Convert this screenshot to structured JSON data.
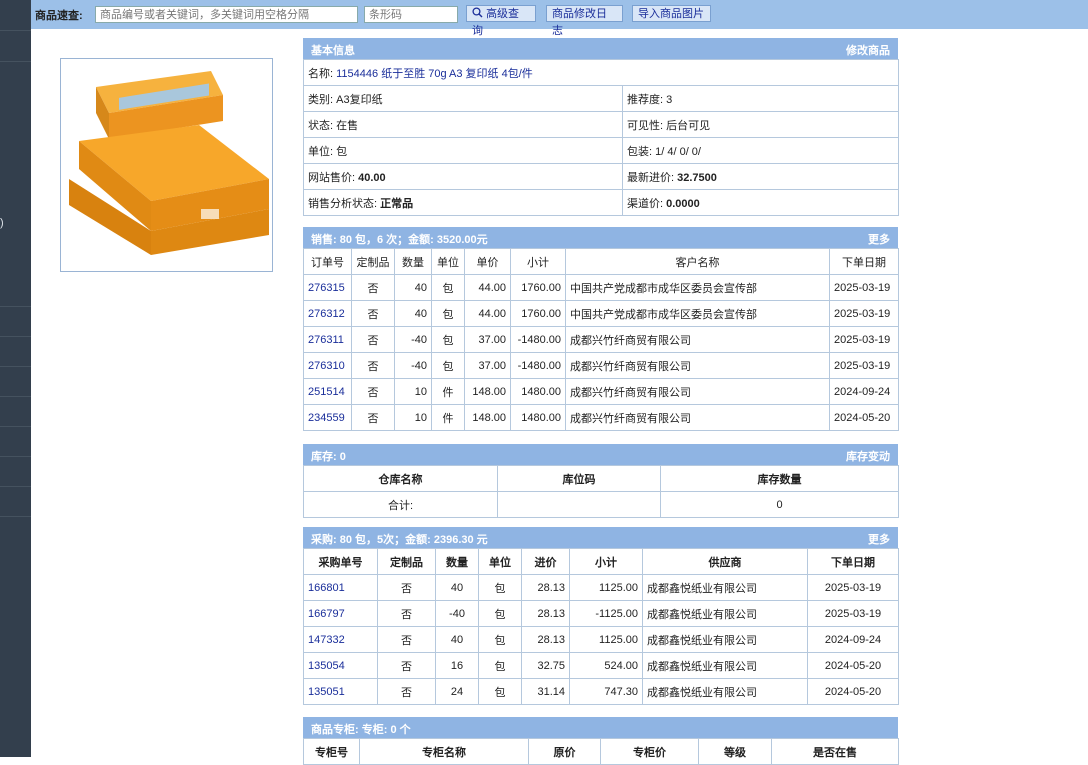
{
  "sidebar": {
    "glyph": ")"
  },
  "search": {
    "label": "商品速查:",
    "keyword_placeholder": "商品编号或者关键词，多关键词用空格分隔",
    "barcode_placeholder": "条形码",
    "advanced_label": "高级查询",
    "log_label": "商品修改日志",
    "import_label": "导入商品图片"
  },
  "basic": {
    "title": "基本信息",
    "edit_label": "修改商品",
    "name_label": "名称:",
    "name": "1154446 纸于至胜 70g A3 复印纸 4包/件",
    "category": "类别:  A3复印纸",
    "recommend": "推荐度:  3",
    "status": "状态:   在售",
    "visibility": "可见性:   后台可见",
    "unit": "单位:  包",
    "pack": "包装:   1/ 4/ 0/ 0/",
    "site_price_label": "网站售价:",
    "site_price": "40.00",
    "latest_cost_label": "最新进价:",
    "latest_cost": "32.7500",
    "sales_status_label": "销售分析状态:",
    "sales_status": "正常品",
    "channel_price_label": "渠道价:",
    "channel_price": "0.0000"
  },
  "sales": {
    "title": "销售:   80 包，6 次；金额:   3520.00元",
    "more": "更多",
    "headers": [
      "订单号",
      "定制品",
      "数量",
      "单位",
      "单价",
      "小计",
      "客户名称",
      "下单日期"
    ],
    "rows": [
      [
        "276315",
        "否",
        "40",
        "包",
        "44.00",
        "1760.00",
        "中国共产党成都市成华区委员会宣传部",
        "2025-03-19"
      ],
      [
        "276312",
        "否",
        "40",
        "包",
        "44.00",
        "1760.00",
        "中国共产党成都市成华区委员会宣传部",
        "2025-03-19"
      ],
      [
        "276311",
        "否",
        "-40",
        "包",
        "37.00",
        "-1480.00",
        "成都兴竹纤商贸有限公司",
        "2025-03-19"
      ],
      [
        "276310",
        "否",
        "-40",
        "包",
        "37.00",
        "-1480.00",
        "成都兴竹纤商贸有限公司",
        "2025-03-19"
      ],
      [
        "251514",
        "否",
        "10",
        "件",
        "148.00",
        "1480.00",
        "成都兴竹纤商贸有限公司",
        "2024-09-24"
      ],
      [
        "234559",
        "否",
        "10",
        "件",
        "148.00",
        "1480.00",
        "成都兴竹纤商贸有限公司",
        "2024-05-20"
      ]
    ]
  },
  "stock": {
    "title": "库存:   0",
    "action": "库存变动",
    "headers": [
      "仓库名称",
      "库位码",
      "库存数量"
    ],
    "total_label": "合计:",
    "total_code": "",
    "total_qty": "0"
  },
  "purchase": {
    "title": "采购:   80 包，5次；金额:   2396.30 元",
    "more": "更多",
    "headers": [
      "采购单号",
      "定制品",
      "数量",
      "单位",
      "进价",
      "小计",
      "供应商",
      "下单日期"
    ],
    "rows": [
      [
        "166801",
        "否",
        "40",
        "包",
        "28.13",
        "1125.00",
        "成都鑫悦纸业有限公司",
        "2025-03-19"
      ],
      [
        "166797",
        "否",
        "-40",
        "包",
        "28.13",
        "-1125.00",
        "成都鑫悦纸业有限公司",
        "2025-03-19"
      ],
      [
        "147332",
        "否",
        "40",
        "包",
        "28.13",
        "1125.00",
        "成都鑫悦纸业有限公司",
        "2024-09-24"
      ],
      [
        "135054",
        "否",
        "16",
        "包",
        "32.75",
        "524.00",
        "成都鑫悦纸业有限公司",
        "2024-05-20"
      ],
      [
        "135051",
        "否",
        "24",
        "包",
        "31.14",
        "747.30",
        "成都鑫悦纸业有限公司",
        "2024-05-20"
      ]
    ]
  },
  "counter": {
    "title": "商品专柜:   专柜:   0 个",
    "headers": [
      "专柜号",
      "专柜名称",
      "原价",
      "专柜价",
      "等级",
      "是否在售"
    ]
  },
  "product_image": {
    "alt": "A3 复印纸"
  },
  "colors": {
    "header": "#8fb4e3",
    "topbar": "#9cc0e8",
    "sidebar": "#333f4d",
    "link": "#1a2e9a"
  }
}
